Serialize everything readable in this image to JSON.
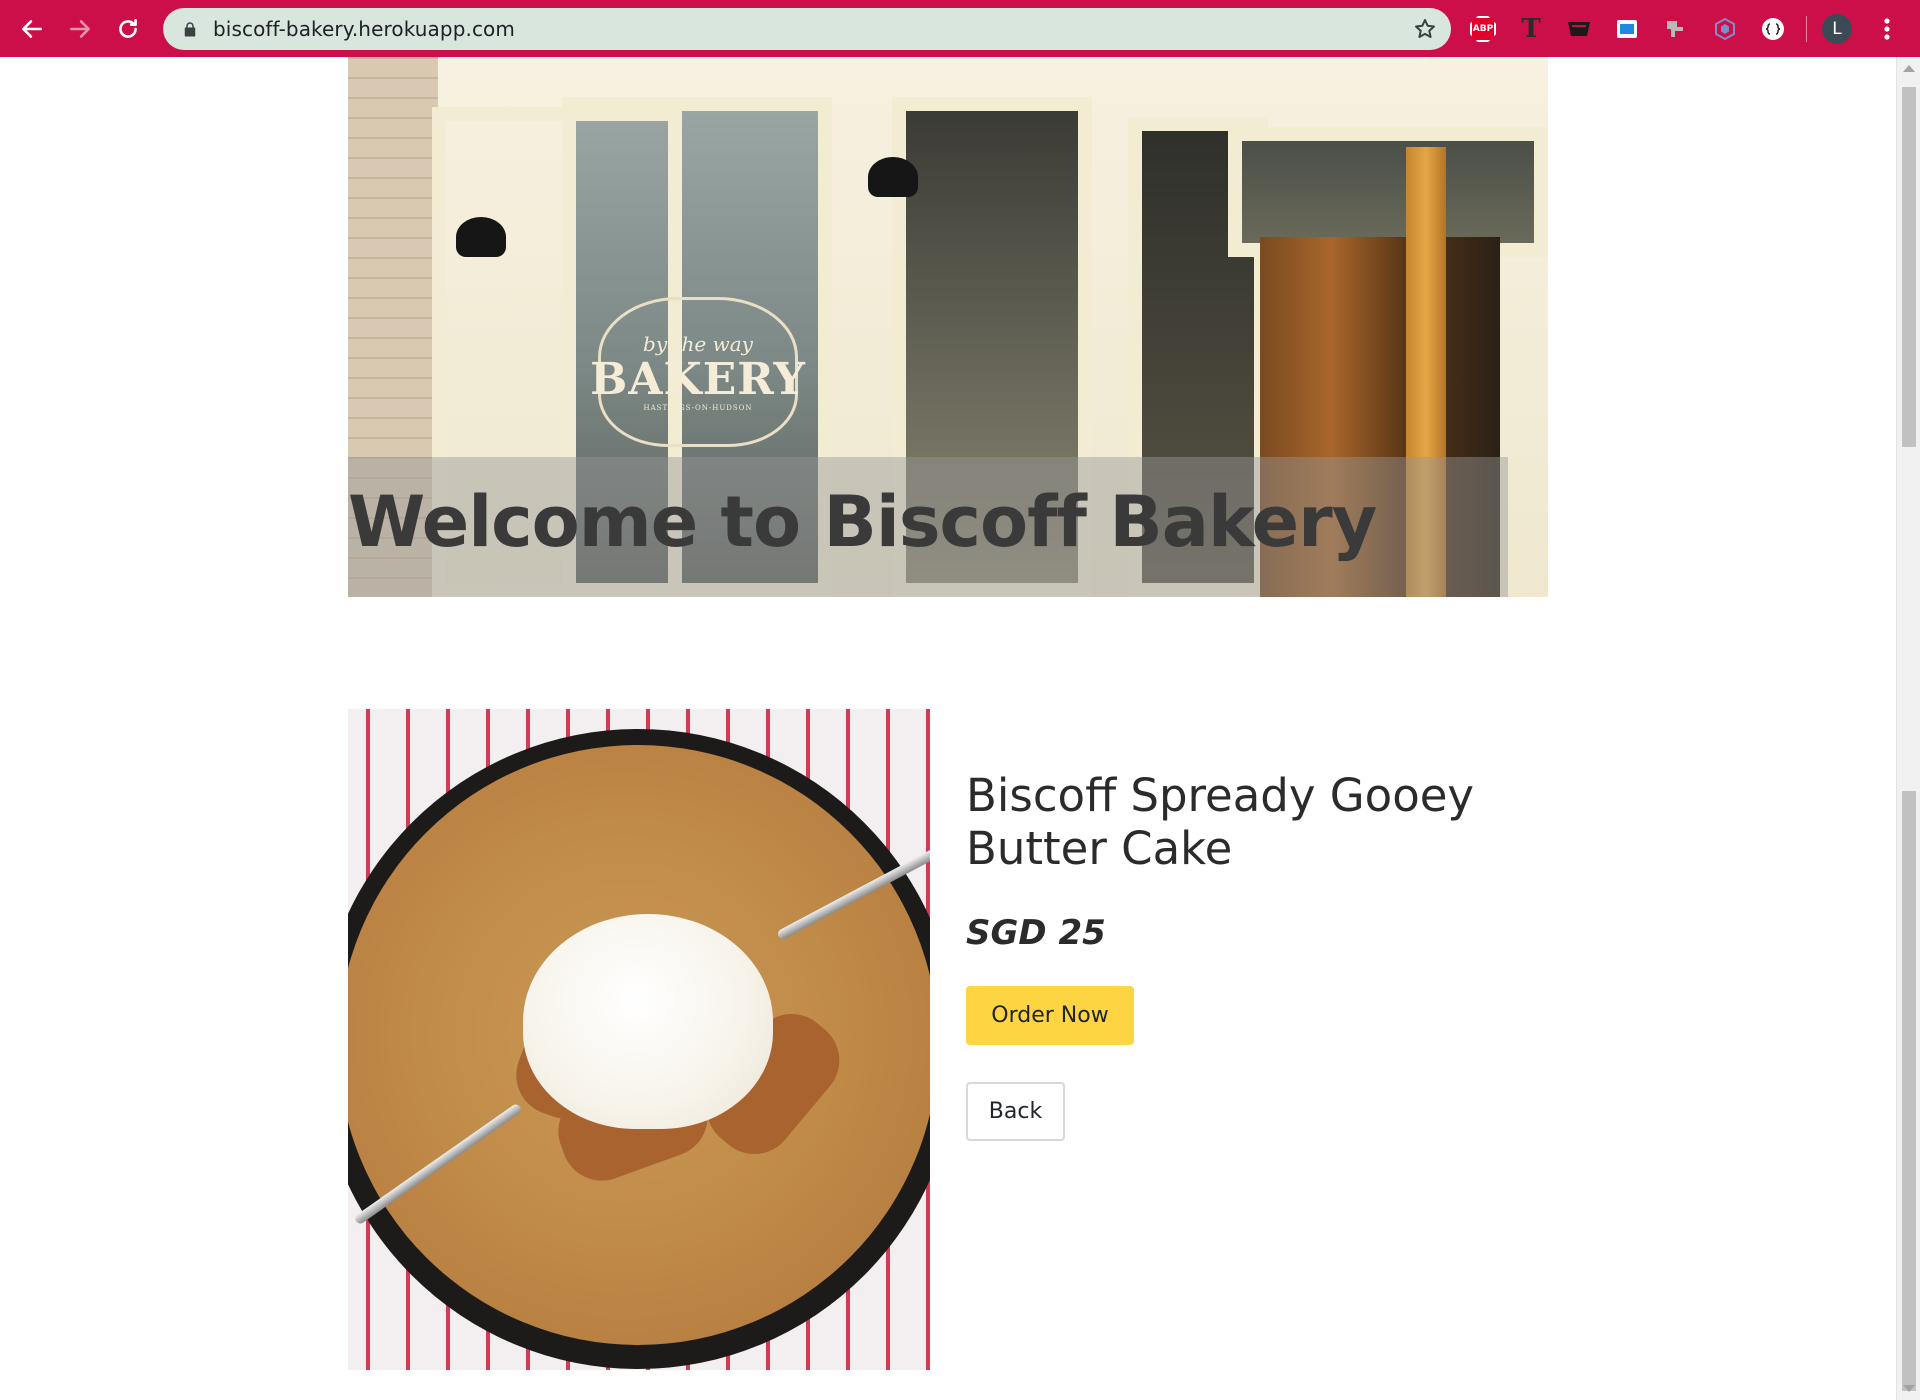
{
  "browser": {
    "url": "biscoff-bakery.herokuapp.com",
    "avatar_letter": "L",
    "extensions": {
      "abp_label": "ABP",
      "t_label": "T"
    },
    "colors": {
      "chrome": "#cc0f49",
      "omnibox": "#d8e6de"
    }
  },
  "hero": {
    "headline": "Welcome to Biscoff Bakery",
    "sign_line1": "by the way",
    "sign_line2": "BAKERY",
    "sign_line3": "HASTINGS-ON-HUDSON"
  },
  "product": {
    "title": "Biscoff Spready Gooey Butter Cake",
    "price": "SGD 25",
    "order_label": "Order Now",
    "back_label": "Back"
  },
  "colors": {
    "order_button": "#fdd442"
  }
}
